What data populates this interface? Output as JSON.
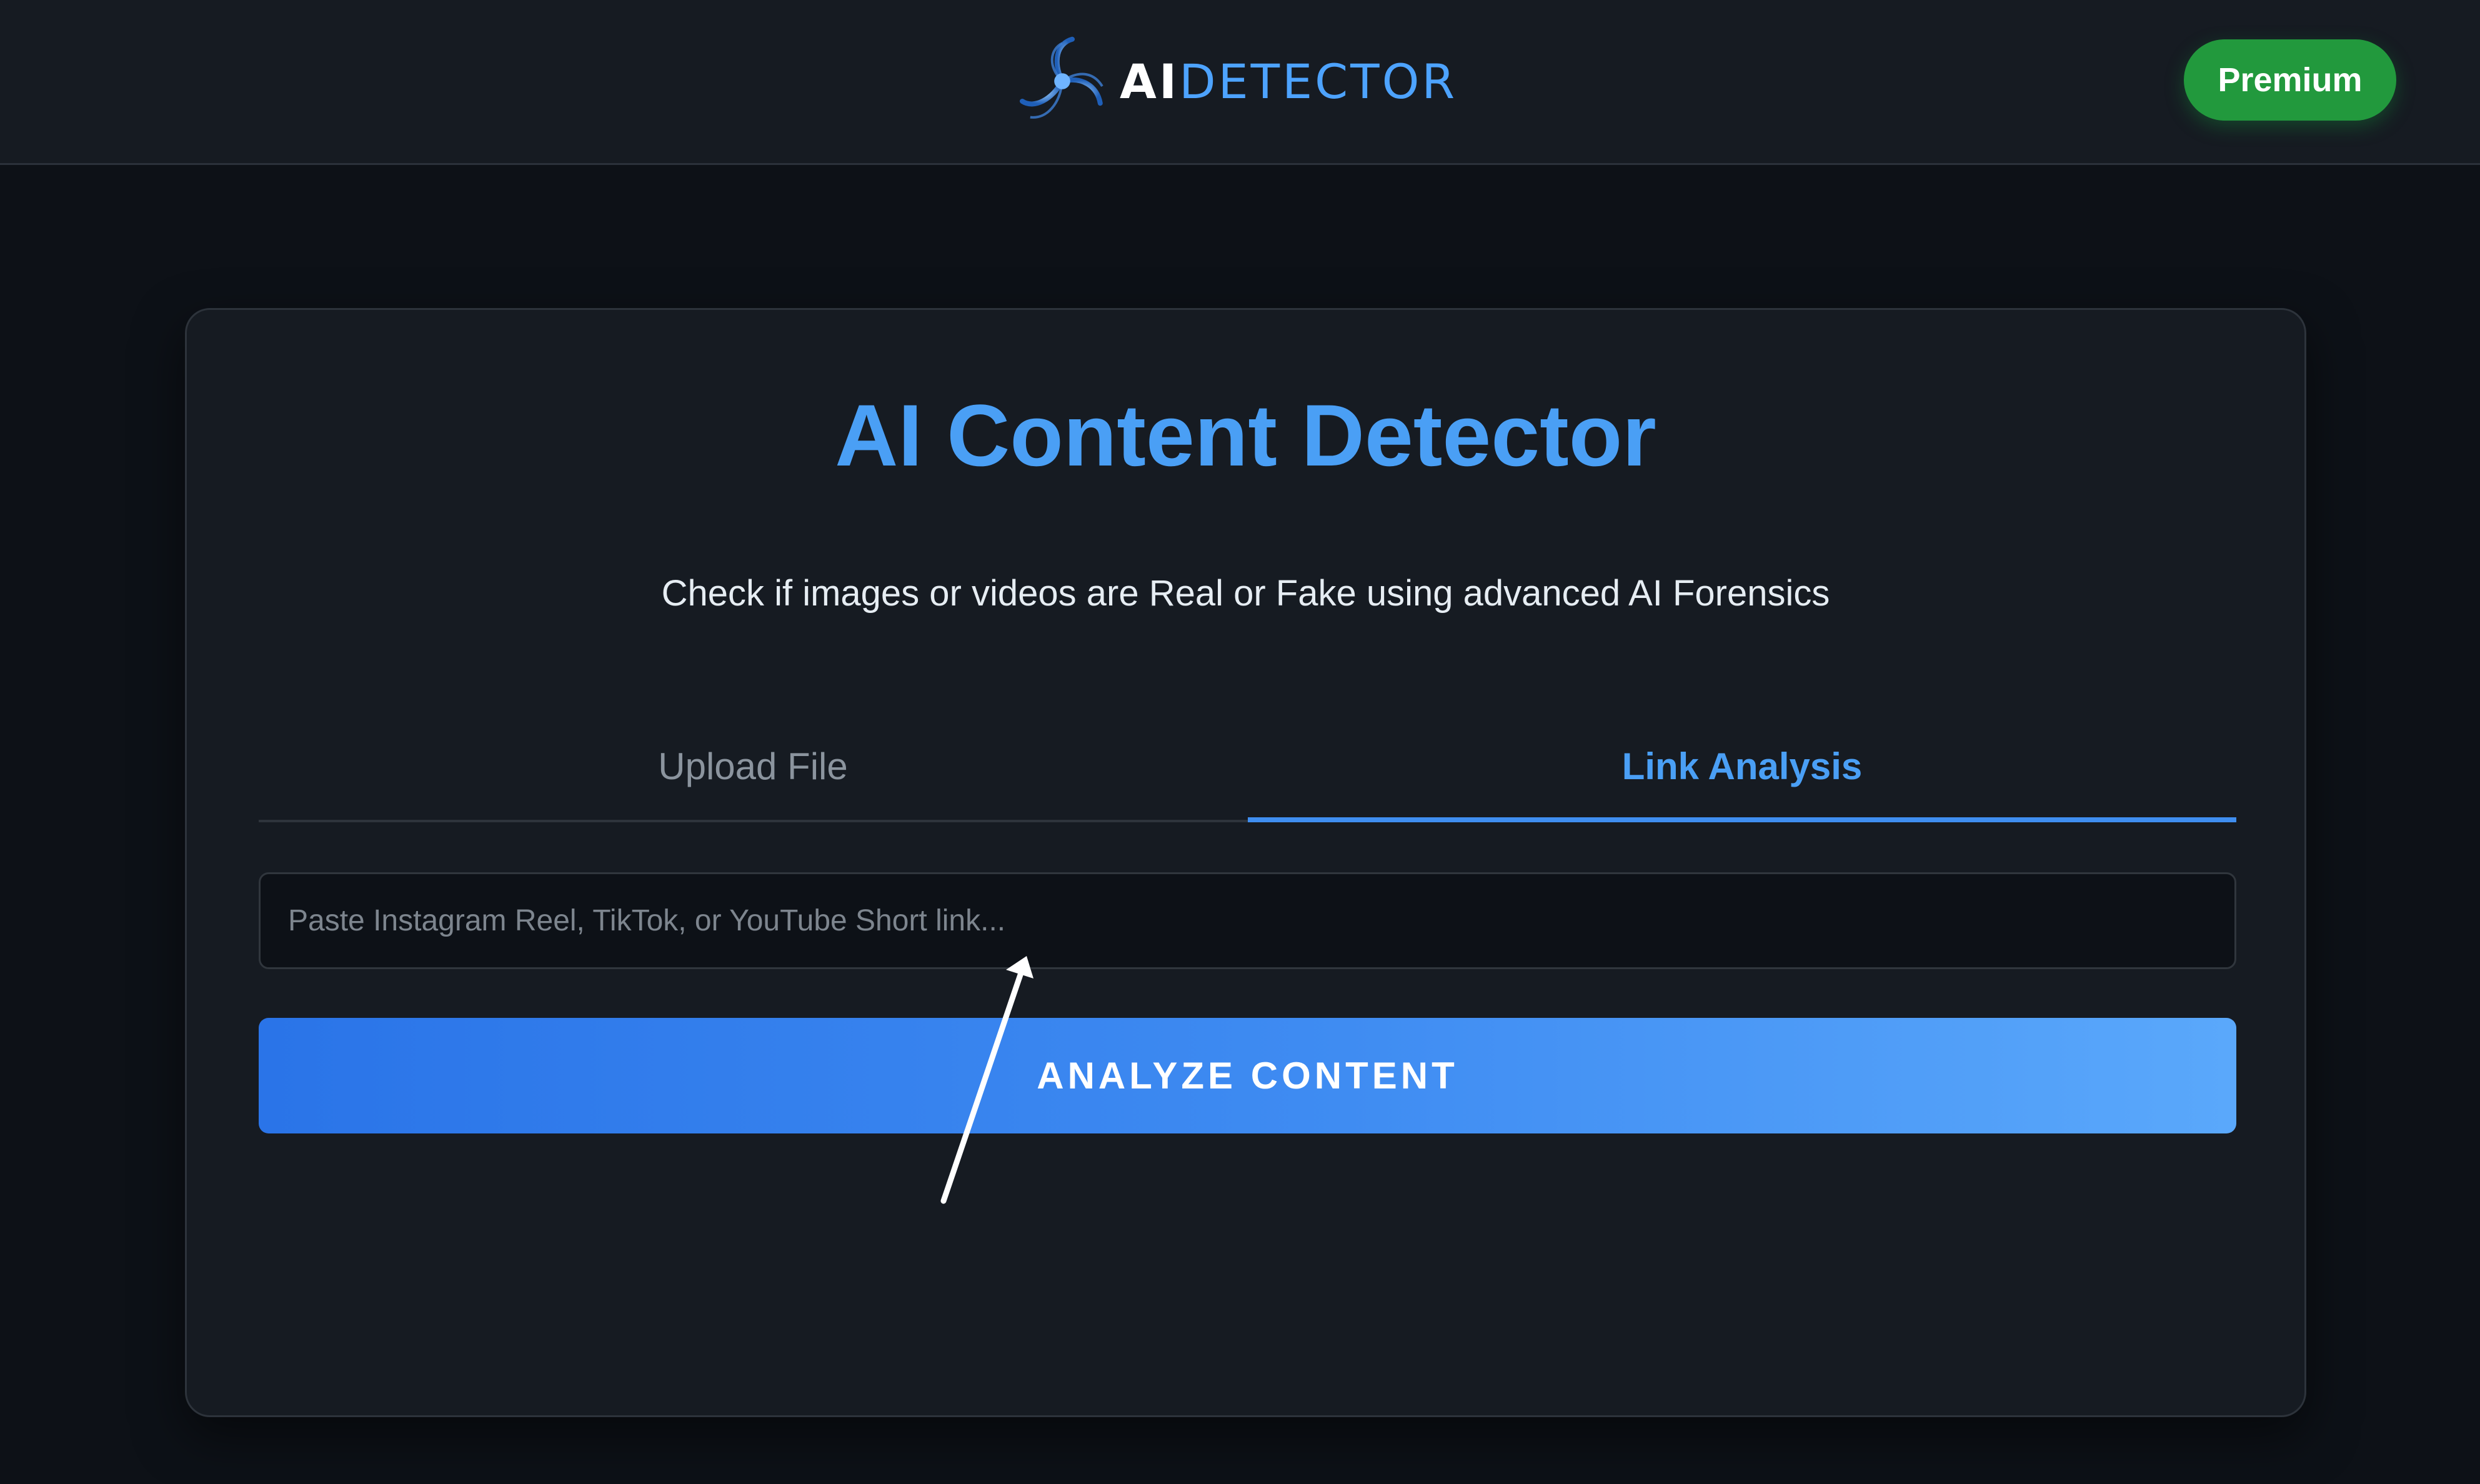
{
  "header": {
    "logo_text_ai": "AI",
    "logo_text_rest": "DETECTOR",
    "premium_label": "Premium"
  },
  "main": {
    "title": "AI Content Detector",
    "subtitle": "Check if images or videos are Real or Fake using advanced AI Forensics",
    "tabs": [
      {
        "label": "Upload File",
        "active": false
      },
      {
        "label": "Link Analysis",
        "active": true
      }
    ],
    "link_input": {
      "value": "",
      "placeholder": "Paste Instagram Reel, TikTok, or YouTube Short link..."
    },
    "analyze_label": "ANALYZE CONTENT"
  },
  "colors": {
    "accent": "#4a9ff5",
    "premium": "#22993d",
    "background": "#0d1117",
    "card": "#161b22"
  },
  "icons": {
    "logo": "ai-detector-logo-icon"
  }
}
